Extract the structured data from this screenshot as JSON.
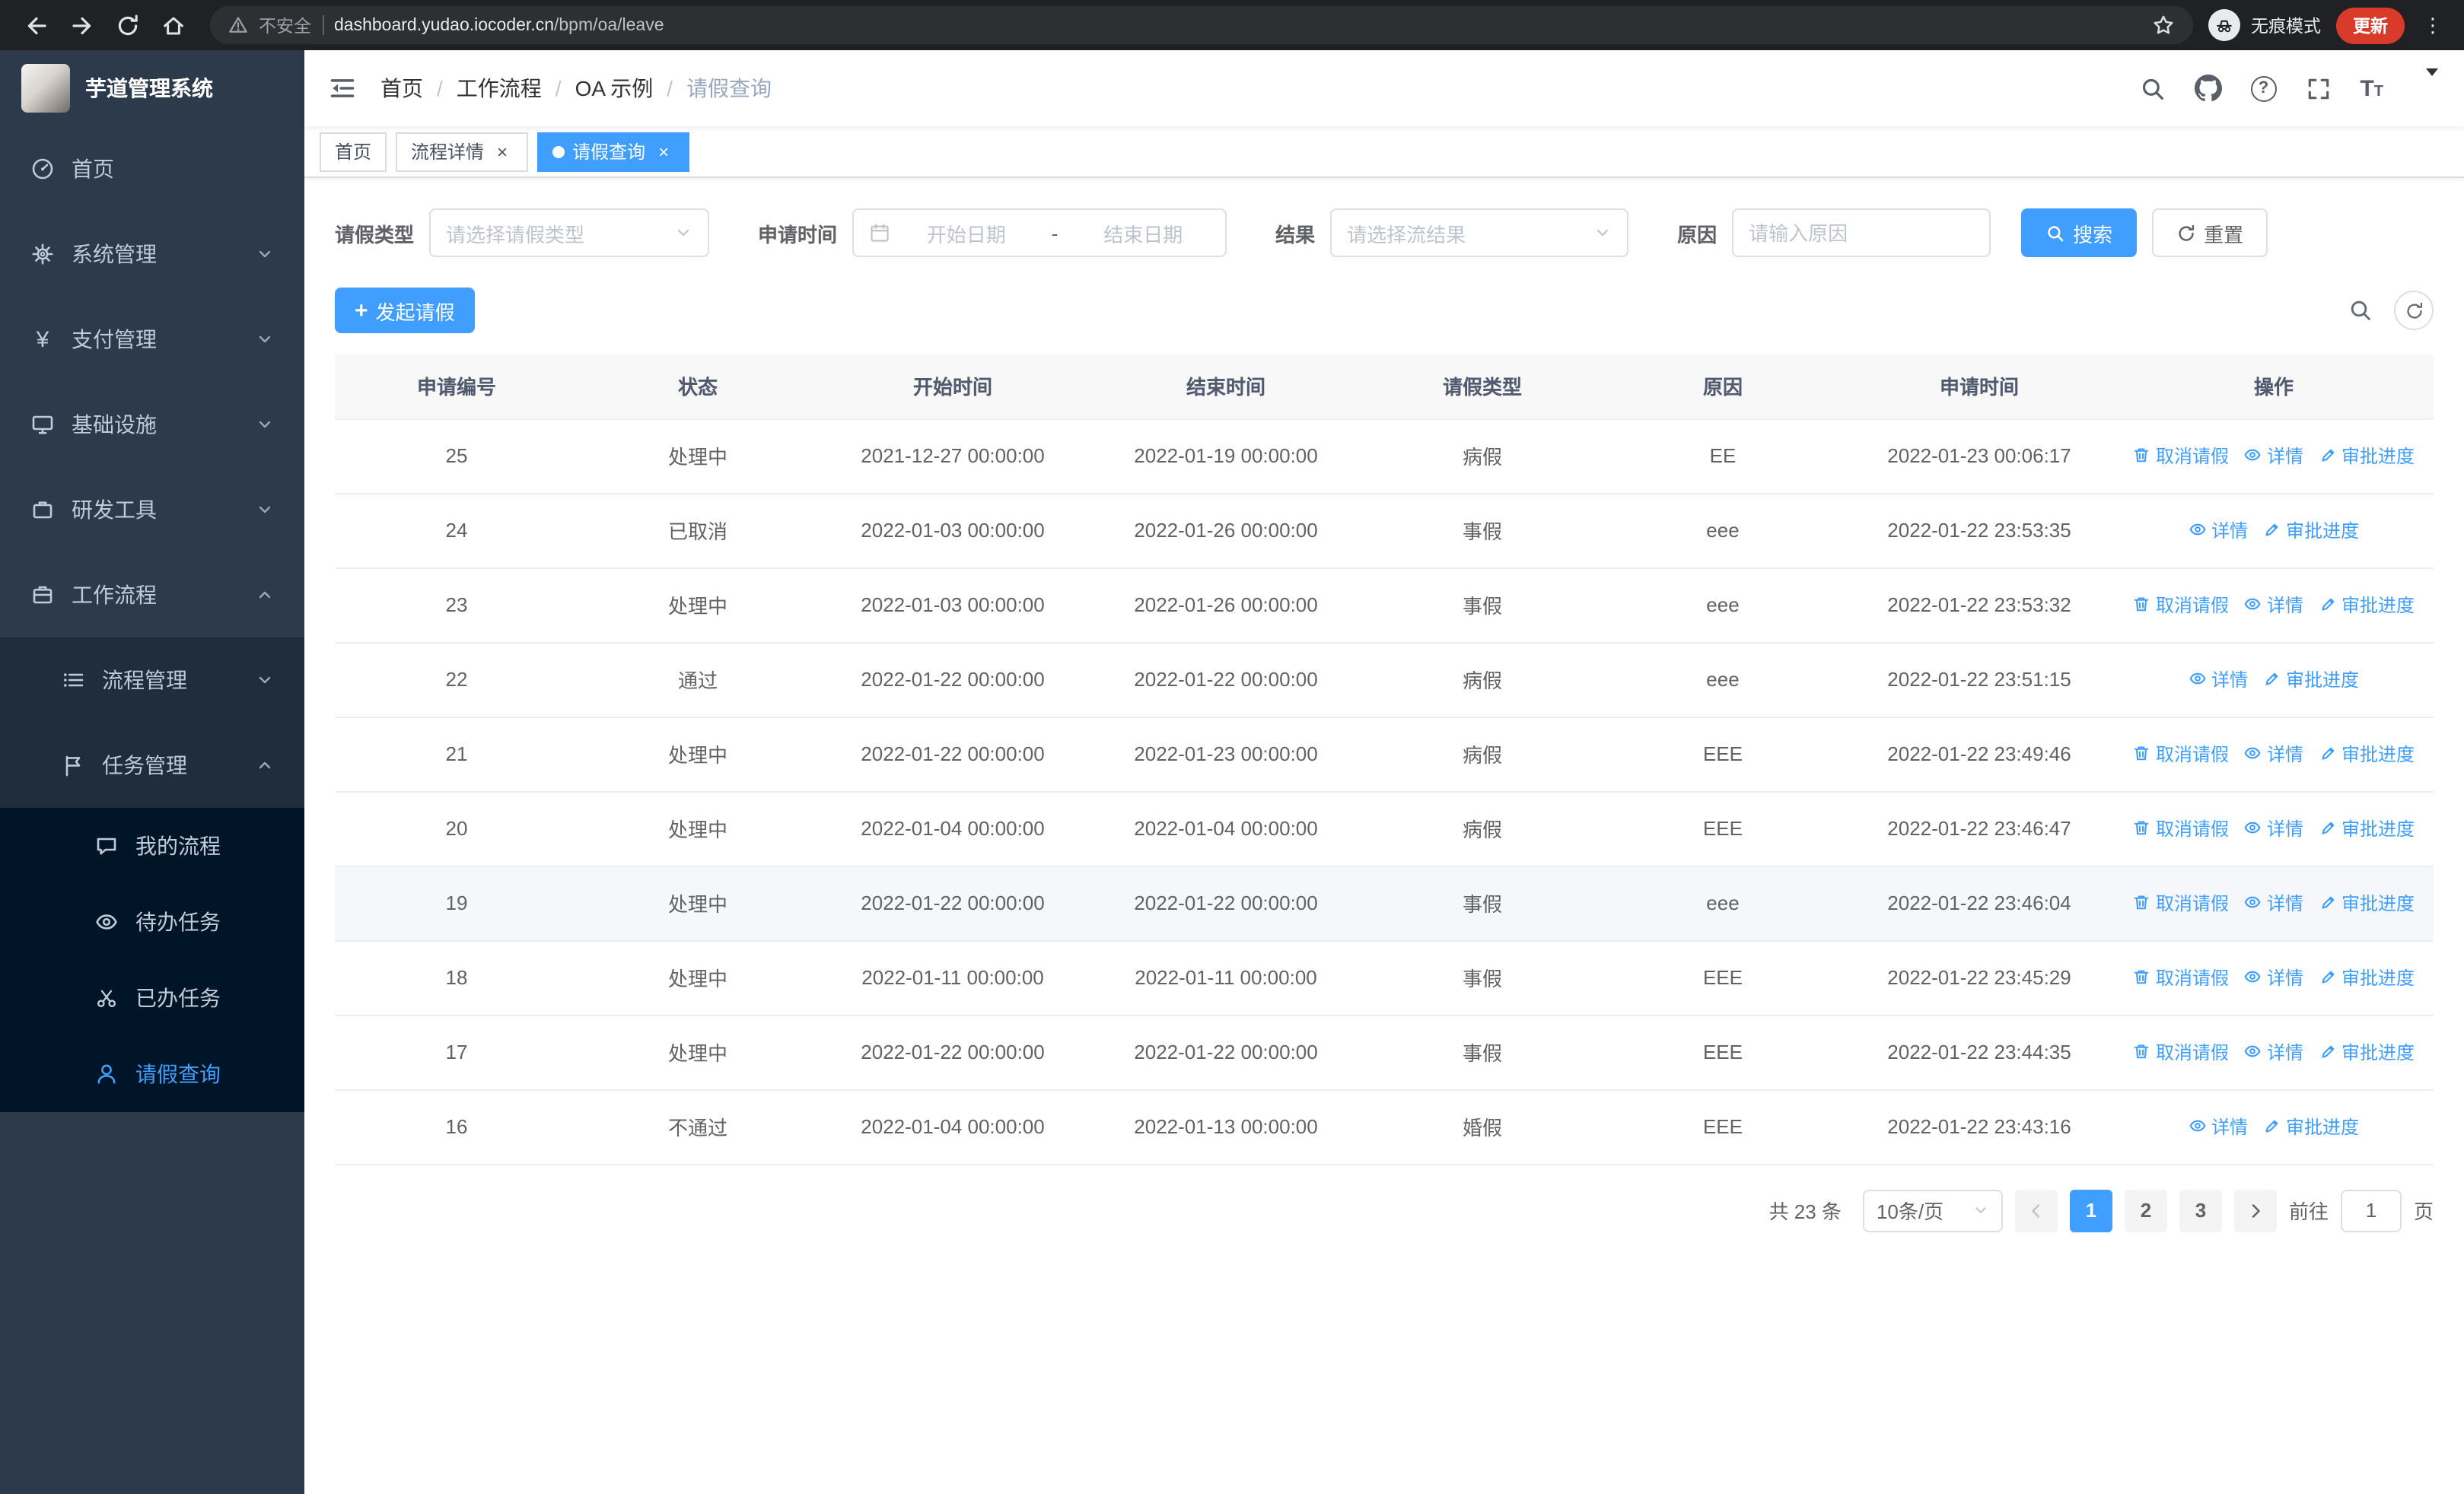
{
  "browser": {
    "security_warning": "不安全",
    "url_host": "dashboard.yudao.iocoder.cn",
    "url_path": "/bpm/oa/leave",
    "incognito_label": "无痕模式",
    "update_button": "更新"
  },
  "sidebar": {
    "logo_title": "芋道管理系统",
    "menu": {
      "home": "首页",
      "system": "系统管理",
      "pay": "支付管理",
      "infra": "基础设施",
      "tools": "研发工具",
      "workflow": "工作流程",
      "process_mgmt": "流程管理",
      "task_mgmt": "任务管理",
      "my_process": "我的流程",
      "todo_tasks": "待办任务",
      "done_tasks": "已办任务",
      "leave_query": "请假查询"
    }
  },
  "header": {
    "breadcrumb": [
      "首页",
      "工作流程",
      "OA 示例",
      "请假查询"
    ]
  },
  "tabs": [
    {
      "label": "首页"
    },
    {
      "label": "流程详情"
    },
    {
      "label": "请假查询"
    }
  ],
  "filter": {
    "leave_type_label": "请假类型",
    "leave_type_placeholder": "请选择请假类型",
    "apply_time_label": "申请时间",
    "start_date_placeholder": "开始日期",
    "range_separator": "-",
    "end_date_placeholder": "结束日期",
    "result_label": "结果",
    "result_placeholder": "请选择流结果",
    "reason_label": "原因",
    "reason_placeholder": "请输入原因",
    "search_button": "搜索",
    "reset_button": "重置"
  },
  "toolbar": {
    "create_button": "发起请假"
  },
  "table": {
    "headers": [
      "申请编号",
      "状态",
      "开始时间",
      "结束时间",
      "请假类型",
      "原因",
      "申请时间",
      "操作"
    ],
    "action_labels": {
      "cancel": "取消请假",
      "detail": "详情",
      "progress": "审批进度"
    },
    "rows": [
      {
        "id": "25",
        "status": "处理中",
        "start": "2021-12-27 00:00:00",
        "end": "2022-01-19 00:00:00",
        "type": "病假",
        "reason": "EE",
        "applied": "2022-01-23 00:06:17",
        "actions": [
          "cancel",
          "detail",
          "progress"
        ],
        "highlighted": false
      },
      {
        "id": "24",
        "status": "已取消",
        "start": "2022-01-03 00:00:00",
        "end": "2022-01-26 00:00:00",
        "type": "事假",
        "reason": "eee",
        "applied": "2022-01-22 23:53:35",
        "actions": [
          "detail",
          "progress"
        ],
        "highlighted": false
      },
      {
        "id": "23",
        "status": "处理中",
        "start": "2022-01-03 00:00:00",
        "end": "2022-01-26 00:00:00",
        "type": "事假",
        "reason": "eee",
        "applied": "2022-01-22 23:53:32",
        "actions": [
          "cancel",
          "detail",
          "progress"
        ],
        "highlighted": false
      },
      {
        "id": "22",
        "status": "通过",
        "start": "2022-01-22 00:00:00",
        "end": "2022-01-22 00:00:00",
        "type": "病假",
        "reason": "eee",
        "applied": "2022-01-22 23:51:15",
        "actions": [
          "detail",
          "progress"
        ],
        "highlighted": false
      },
      {
        "id": "21",
        "status": "处理中",
        "start": "2022-01-22 00:00:00",
        "end": "2022-01-23 00:00:00",
        "type": "病假",
        "reason": "EEE",
        "applied": "2022-01-22 23:49:46",
        "actions": [
          "cancel",
          "detail",
          "progress"
        ],
        "highlighted": false
      },
      {
        "id": "20",
        "status": "处理中",
        "start": "2022-01-04 00:00:00",
        "end": "2022-01-04 00:00:00",
        "type": "病假",
        "reason": "EEE",
        "applied": "2022-01-22 23:46:47",
        "actions": [
          "cancel",
          "detail",
          "progress"
        ],
        "highlighted": false
      },
      {
        "id": "19",
        "status": "处理中",
        "start": "2022-01-22 00:00:00",
        "end": "2022-01-22 00:00:00",
        "type": "事假",
        "reason": "eee",
        "applied": "2022-01-22 23:46:04",
        "actions": [
          "cancel",
          "detail",
          "progress"
        ],
        "highlighted": true
      },
      {
        "id": "18",
        "status": "处理中",
        "start": "2022-01-11 00:00:00",
        "end": "2022-01-11 00:00:00",
        "type": "事假",
        "reason": "EEE",
        "applied": "2022-01-22 23:45:29",
        "actions": [
          "cancel",
          "detail",
          "progress"
        ],
        "highlighted": false
      },
      {
        "id": "17",
        "status": "处理中",
        "start": "2022-01-22 00:00:00",
        "end": "2022-01-22 00:00:00",
        "type": "事假",
        "reason": "EEE",
        "applied": "2022-01-22 23:44:35",
        "actions": [
          "cancel",
          "detail",
          "progress"
        ],
        "highlighted": false
      },
      {
        "id": "16",
        "status": "不通过",
        "start": "2022-01-04 00:00:00",
        "end": "2022-01-13 00:00:00",
        "type": "婚假",
        "reason": "EEE",
        "applied": "2022-01-22 23:43:16",
        "actions": [
          "detail",
          "progress"
        ],
        "highlighted": false
      }
    ]
  },
  "pagination": {
    "total": "共 23 条",
    "page_size": "10条/页",
    "pages": [
      "1",
      "2",
      "3"
    ],
    "current_page": "1",
    "goto_label": "前往",
    "goto_value": "1",
    "goto_unit": "页"
  }
}
